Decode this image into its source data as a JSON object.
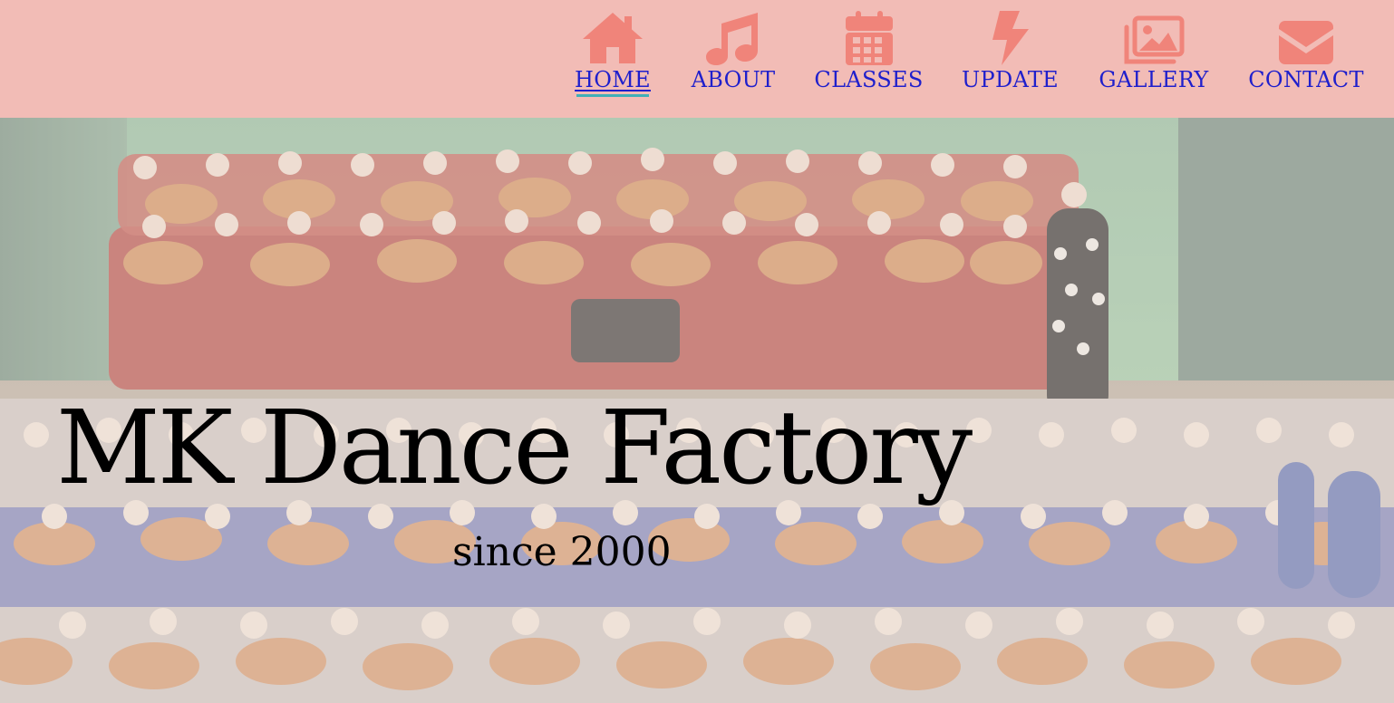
{
  "header": {
    "background": "#f2bcb6",
    "icon_color": "#f0847a",
    "link_color": "#1f1fcc",
    "active_underline_color": "#3fb0b8"
  },
  "nav": {
    "items": [
      {
        "label": "HOME",
        "icon": "home-icon",
        "active": true
      },
      {
        "label": "ABOUT",
        "icon": "music-note-icon",
        "active": false
      },
      {
        "label": "CLASSES",
        "icon": "calendar-icon",
        "active": false
      },
      {
        "label": "UPDATE",
        "icon": "lightning-bolt-icon",
        "active": false
      },
      {
        "label": "GALLERY",
        "icon": "images-icon",
        "active": false
      },
      {
        "label": "CONTACT",
        "icon": "envelope-icon",
        "active": false
      }
    ]
  },
  "hero": {
    "title": "MK Dance Factory",
    "subtitle": "since 2000"
  }
}
